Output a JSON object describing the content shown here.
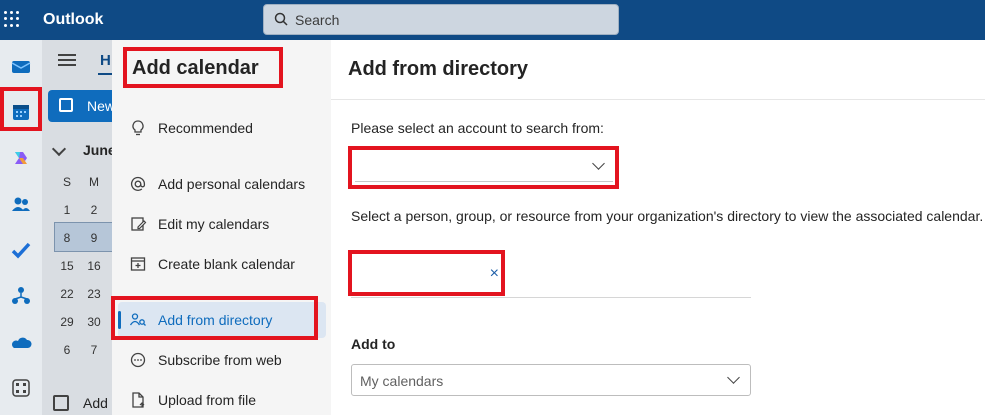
{
  "topbar": {
    "app_title": "Outlook",
    "search_placeholder": "Search"
  },
  "rail": {
    "items": [
      "mail-icon",
      "calendar-icon",
      "copilot-icon",
      "people-icon",
      "todo-icon",
      "org-icon",
      "onedrive-icon",
      "apps-icon"
    ]
  },
  "calendar_pane": {
    "home_tab": "H",
    "new_label": "New",
    "month_label": "June",
    "weekdays": [
      "S",
      "M"
    ],
    "rows": [
      [
        "1",
        "2"
      ],
      [
        "8",
        "9"
      ],
      [
        "15",
        "16"
      ],
      [
        "22",
        "23"
      ],
      [
        "29",
        "30"
      ],
      [
        "6",
        "7"
      ]
    ],
    "add_calendar_label": "Add"
  },
  "dialog": {
    "title": "Add calendar",
    "nav": [
      {
        "label": "Recommended",
        "icon": "lightbulb-icon"
      },
      {
        "label": "Add personal calendars",
        "icon": "at-icon"
      },
      {
        "label": "Edit my calendars",
        "icon": "edit-icon"
      },
      {
        "label": "Create blank calendar",
        "icon": "calendar-add-icon"
      },
      {
        "label": "Add from directory",
        "icon": "people-search-icon",
        "active": true
      },
      {
        "label": "Subscribe from web",
        "icon": "web-icon"
      },
      {
        "label": "Upload from file",
        "icon": "file-upload-icon"
      }
    ]
  },
  "main": {
    "title": "Add from directory",
    "account_prompt": "Please select an account to search from:",
    "account_value": "",
    "directory_prompt": "Select a person, group, or resource from your organization's directory to view the associated calendar.",
    "person_value": "",
    "clear_glyph": "×",
    "add_to_label": "Add to",
    "add_to_value": "My calendars"
  },
  "colors": {
    "topbar": "#0f4a85",
    "accent": "#0f6cbd",
    "annotation": "#e3141f"
  }
}
